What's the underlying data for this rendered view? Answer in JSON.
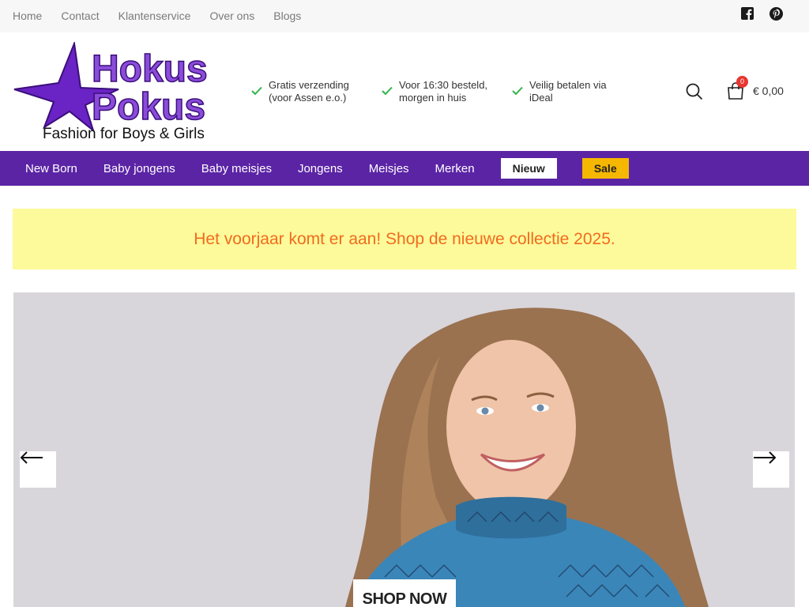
{
  "topbar": {
    "links": [
      "Home",
      "Contact",
      "Klantenservice",
      "Over ons",
      "Blogs"
    ],
    "social": [
      "facebook-icon",
      "pinterest-icon"
    ]
  },
  "header": {
    "logo": {
      "line1": "Hokus",
      "line2": "Pokus",
      "tagline": "Fashion for Boys & Girls"
    },
    "usps": [
      "Gratis verzending (voor Assen e.o.)",
      "Voor 16:30 besteld, morgen in huis",
      "Veilig betalen via iDeal"
    ],
    "cart": {
      "count": "0",
      "total": "€ 0,00"
    }
  },
  "mainnav": {
    "items": [
      "New Born",
      "Baby jongens",
      "Baby meisjes",
      "Jongens",
      "Meisjes",
      "Merken"
    ],
    "new_label": "Nieuw",
    "sale_label": "Sale"
  },
  "promo": {
    "text": "Het voorjaar komt er aan! Shop de nieuwe collectie 2025."
  },
  "hero": {
    "cta": "SHOP NOW"
  },
  "colors": {
    "brand_purple": "#5b24a5",
    "promo_bg": "#fdfa9b",
    "promo_text": "#f26b1d",
    "sale_bg": "#f5b700",
    "check_green": "#2fb34a",
    "badge_red": "#e8352f"
  }
}
